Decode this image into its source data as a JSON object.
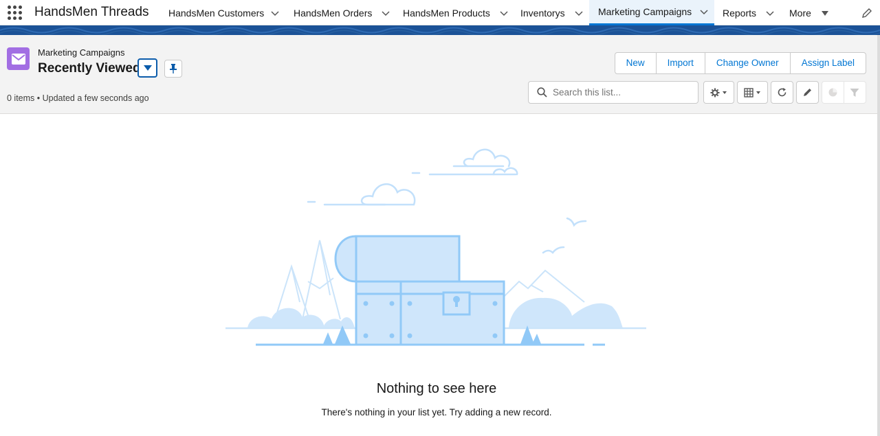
{
  "app": {
    "name": "HandsMen Threads"
  },
  "nav": {
    "items": [
      {
        "label": "HandsMen Customers"
      },
      {
        "label": "HandsMen Orders"
      },
      {
        "label": "HandsMen Products"
      },
      {
        "label": "Inventorys"
      },
      {
        "label": "Marketing Campaigns",
        "active": true
      },
      {
        "label": "Reports"
      },
      {
        "label": "More"
      }
    ]
  },
  "header": {
    "object_label": "Marketing Campaigns",
    "list_view_name": "Recently Viewed",
    "status": "0 items • Updated a few seconds ago",
    "object_icon": "envelope-icon",
    "accent_color": "#a26ee3"
  },
  "actions": {
    "new": "New",
    "import": "Import",
    "change_owner": "Change Owner",
    "assign_label": "Assign Label"
  },
  "search": {
    "placeholder": "Search this list...",
    "value": ""
  },
  "toolbar": {
    "icons": [
      "gear-icon",
      "table-icon",
      "refresh-icon",
      "pencil-icon",
      "chart-icon",
      "filter-icon"
    ]
  },
  "empty_state": {
    "title": "Nothing to see here",
    "message": "There's nothing in your list yet. Try adding a new record."
  },
  "colors": {
    "brand": "#0176d3",
    "band": "#1b5297"
  }
}
